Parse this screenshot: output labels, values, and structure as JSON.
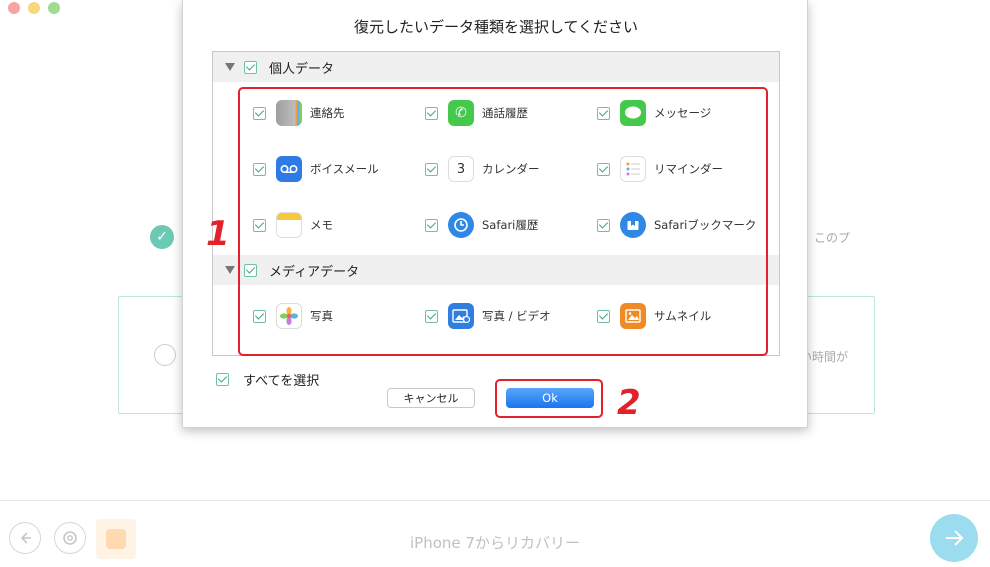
{
  "background": {
    "side_text_1": "このプ",
    "side_text_2": "い時間が",
    "bottom_title": "iPhone 7からリカバリー"
  },
  "dialog": {
    "title": "復元したいデータ種類を選択してください",
    "sections": [
      {
        "label": "個人データ",
        "items": [
          {
            "label": "連絡先",
            "icon": "contacts-icon"
          },
          {
            "label": "通話履歴",
            "icon": "phone-icon"
          },
          {
            "label": "メッセージ",
            "icon": "messages-icon"
          },
          {
            "label": "ボイスメール",
            "icon": "voicemail-icon"
          },
          {
            "label": "カレンダー",
            "icon": "calendar-icon"
          },
          {
            "label": "リマインダー",
            "icon": "reminders-icon"
          },
          {
            "label": "メモ",
            "icon": "notes-icon"
          },
          {
            "label": "Safari履歴",
            "icon": "safari-icon"
          },
          {
            "label": "Safariブックマーク",
            "icon": "bookmark-icon"
          }
        ]
      },
      {
        "label": "メディアデータ",
        "items": [
          {
            "label": "写真",
            "icon": "photos-icon"
          },
          {
            "label": "写真 / ビデオ",
            "icon": "photo-video-icon"
          },
          {
            "label": "サムネイル",
            "icon": "thumbnail-icon"
          }
        ]
      }
    ],
    "calendar_day": "3",
    "select_all_label": "すべてを選択",
    "cancel_label": "キャンセル",
    "ok_label": "Ok"
  },
  "annotations": {
    "marker_1": "1",
    "marker_2": "2"
  },
  "colors": {
    "accent": "#1b74ee",
    "checkbox": "#3aa58a",
    "annotation": "#e3212a"
  }
}
